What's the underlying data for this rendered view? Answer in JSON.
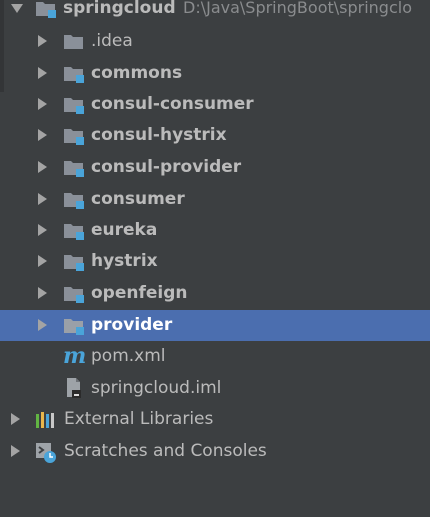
{
  "root": {
    "name": "springcloud",
    "path": "D:\\Java\\SpringBoot\\springclo"
  },
  "folders": [
    {
      "name": ".idea",
      "module": false
    },
    {
      "name": "commons",
      "module": true
    },
    {
      "name": "consul-consumer",
      "module": true
    },
    {
      "name": "consul-hystrix",
      "module": true
    },
    {
      "name": "consul-provider",
      "module": true
    },
    {
      "name": "consumer",
      "module": true
    },
    {
      "name": "eureka",
      "module": true
    },
    {
      "name": "hystrix",
      "module": true
    },
    {
      "name": "openfeign",
      "module": true
    },
    {
      "name": "provider",
      "module": true,
      "selected": true
    }
  ],
  "files": [
    {
      "name": "pom.xml",
      "icon": "maven-m-icon"
    },
    {
      "name": "springcloud.iml",
      "icon": "iml-file-icon"
    }
  ],
  "bottom": [
    {
      "name": "External Libraries",
      "icon": "libraries-icon"
    },
    {
      "name": "Scratches and Consoles",
      "icon": "scratches-icon"
    }
  ],
  "colors": {
    "background": "#3c3f41",
    "selection": "#4b6eaf",
    "folder": "#8a9099",
    "module_badge": "#4aa4d9",
    "text": "#bbbbbb"
  }
}
